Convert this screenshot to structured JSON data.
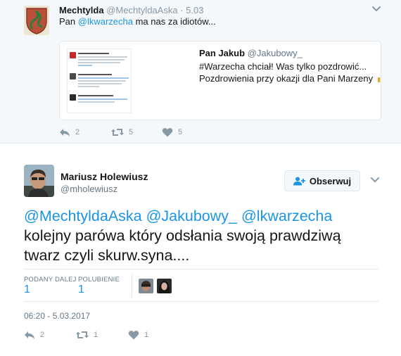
{
  "parent_tweet": {
    "name": "Mechtylda",
    "handle": "@MechtyldaAska",
    "separator": "·",
    "time": "5.03",
    "text_prefix": "Pan ",
    "mention": "@lkwarzecha",
    "text_suffix": " ma nas za idiotów...",
    "quote": {
      "name": "Pan Jakub",
      "handle": "@Jakubowy_",
      "line1": "#Warzecha chciał! Was tylko pozdrowić...",
      "line2": "Pozdrowienia przy okazji dla Pani Marzeny"
    },
    "actions": {
      "reply_count": "2",
      "retweet_count": "5",
      "like_count": "5"
    }
  },
  "main_tweet": {
    "name": "Mariusz Holewiusz",
    "handle": "@mholewiusz",
    "follow_label": "Obserwuj",
    "mention1": "@MechtyldaAska",
    "mention2": "@Jakubowy_",
    "mention3": "@lkwarzecha",
    "text_line2": "kolejny parówa który odsłania swoją prawdziwą",
    "text_line3": "twarz czyli skurw.syna....",
    "stats": {
      "retweets_label": "PODANY DALEJ",
      "retweets_value": "1",
      "likes_label": "POLUBIENIE",
      "likes_value": "1"
    },
    "date": "06:20 - 5.03.2017",
    "actions": {
      "reply_count": "2",
      "retweet_count": "1",
      "like_count": "1"
    }
  },
  "icons": {
    "reply": "reply-icon",
    "retweet": "retweet-icon",
    "like": "heart-icon",
    "chevron": "chevron-down-icon",
    "follow": "add-user-icon"
  },
  "colors": {
    "link": "#1b95e0",
    "muted": "#8899a6",
    "panel": "#f5f8fa",
    "border": "#e1e8ed"
  }
}
